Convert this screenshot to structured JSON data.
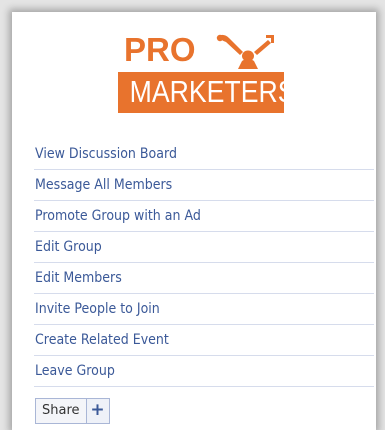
{
  "logo": {
    "line1": "PRO",
    "line2": "MARKETERS",
    "brand_color": "#e8732d"
  },
  "actions": [
    {
      "label": "View Discussion Board",
      "name": "view-discussion-board-link"
    },
    {
      "label": "Message All Members",
      "name": "message-all-members-link"
    },
    {
      "label": "Promote Group with an Ad",
      "name": "promote-group-link"
    },
    {
      "label": "Edit Group",
      "name": "edit-group-link"
    },
    {
      "label": "Edit Members",
      "name": "edit-members-link"
    },
    {
      "label": "Invite People to Join",
      "name": "invite-people-link"
    },
    {
      "label": "Create Related Event",
      "name": "create-related-event-link"
    },
    {
      "label": "Leave Group",
      "name": "leave-group-link"
    }
  ],
  "share": {
    "label": "Share",
    "icon": "plus-icon",
    "symbol": "+"
  },
  "colors": {
    "link": "#3b5998",
    "divider": "#d6dcec"
  }
}
